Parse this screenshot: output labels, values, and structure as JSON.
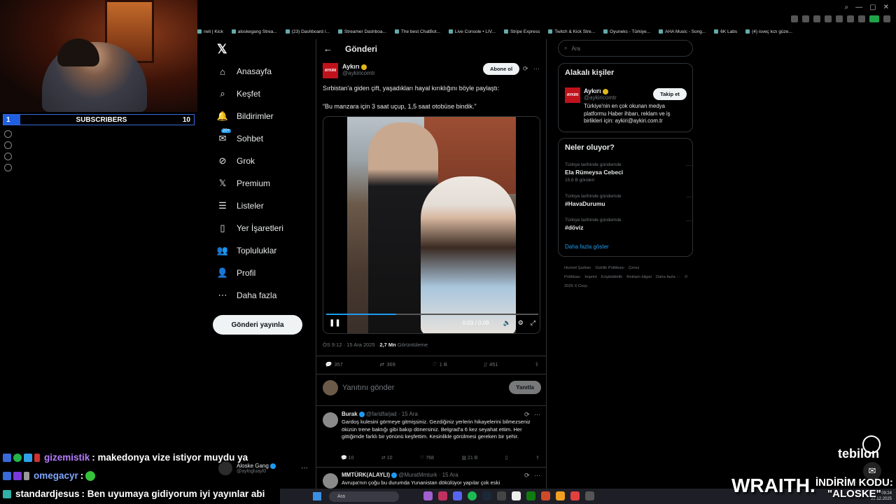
{
  "webcam": {
    "subscribers_label": "SUBSCRIBERS",
    "subscribers_current": "1",
    "subscribers_goal": "10"
  },
  "bookmarks": [
    "neli | Kick",
    "aloskegang Strea...",
    "(23) Dashboard /...",
    "Streamer Dashboa...",
    "The best ChatBot...",
    "Live Console • LIV...",
    "Stripe Express",
    "Twitch & Kick Stre...",
    "Oyuneks - Türkiye...",
    "AHA Music - Song...",
    "6K Labs",
    "(4) isveç kızı güze..."
  ],
  "nav": {
    "items": [
      {
        "label": "Anasayfa",
        "icon": "home-icon"
      },
      {
        "label": "Keşfet",
        "icon": "search-icon"
      },
      {
        "label": "Bildirimler",
        "icon": "bell-icon"
      },
      {
        "label": "Sohbet",
        "icon": "mail-icon",
        "badge": "20+"
      },
      {
        "label": "Grok",
        "icon": "grok-icon"
      },
      {
        "label": "Premium",
        "icon": "x-icon"
      },
      {
        "label": "Listeler",
        "icon": "list-icon"
      },
      {
        "label": "Yer İşaretleri",
        "icon": "bookmark-icon"
      },
      {
        "label": "Topluluklar",
        "icon": "people-icon"
      },
      {
        "label": "Profil",
        "icon": "person-icon"
      },
      {
        "label": "Daha fazla",
        "icon": "more-icon"
      }
    ],
    "post_button": "Gönderi yayınla",
    "account_name": "Aloske Gang",
    "account_handle": "@aylogluayl0"
  },
  "post": {
    "header_title": "Gönderi",
    "author_name": "Aykırı",
    "author_handle": "@aykiricomtr",
    "author_logo": "AYKIRI",
    "subscribe_label": "Abone ol",
    "text1": "Sırbistan'a giden çift, yaşadıkları hayal kırıklığını böyle paylaştı:",
    "text2": "“Bu manzara için 3 saat uçup, 1,5 saat otobüse bindik.”",
    "video_time": "0:03 / 0:09",
    "video_progress": 0.33,
    "meta_time": "ÖS 9:12 · 15 Ara 2025 · ",
    "meta_views": "2,7 Mn",
    "meta_views_label": " Görüntüleme",
    "stats": {
      "replies": "357",
      "reposts": "369",
      "likes": "1 B",
      "bookmarks": "451"
    },
    "reply_placeholder": "Yanıtını gönder",
    "reply_button": "Yanıtla"
  },
  "replies": [
    {
      "name": "Burak",
      "handle": "@faridfarjad",
      "date": "· 15 Ara",
      "text": "Gardoş kulesini görmeye gitmişsiniz. Gezdiğiniz yerlerin hikayelerini bilmezseniz ökizün trene baktığı gibi bakıp dönersiniz. Belgrad'a 6 kez seyahat ettim. Her gittiğimde farklı bir yönünü keşfettim. Kesinlikle görülmesi gereken bir şehir.",
      "stats": {
        "replies": "10",
        "reposts": "10",
        "likes": "768",
        "views": "21 B"
      }
    },
    {
      "name": "MMTÜRK(ALAYLI)",
      "handle": "@MuratMmturk",
      "date": "· 15 Ara",
      "text": "Avrupa'nın çoğu bu durumda Yunanistan dökülüyor yapılar çok eski"
    }
  ],
  "right": {
    "search_placeholder": "Ara",
    "relevant_title": "Alakalı kişiler",
    "relevant_name": "Aykırı",
    "relevant_handle": "@aykiricomtr",
    "relevant_bio": "Türkiye'nin en çok okunan medya platformu Haber ihbarı, reklam ve iş birlikleri için: aykiri@aykiri.com.tr",
    "follow_label": "Takip et",
    "trends_title": "Neler oluyor?",
    "trends": [
      {
        "context": "Türkiye tarihinde gündemde",
        "title": "Ela Rümeysa Cebeci",
        "count": "15,6 B gönderi"
      },
      {
        "context": "Türkiye tarihinde gündemde",
        "title": "#HavaDurumu",
        "count": ""
      },
      {
        "context": "Türkiye tarihinde gündemde",
        "title": "#döviz",
        "count": ""
      }
    ],
    "show_more": "Daha fazla göster",
    "footer_links": [
      "Hizmet Şartları",
      "Gizlilik Politikası",
      "Çerez Politikası",
      "Imprint",
      "Erişilebilirlik",
      "Reklam bilgisi",
      "Daha fazla ···",
      "© 2025 X Corp."
    ]
  },
  "chat": [
    {
      "user": "gizemistik",
      "user_color": "#b57dff",
      "text": ": makedonya vize istiyor muydu ya"
    },
    {
      "user": "omegacyr",
      "user_color": "#7ea6ff",
      "text": ": "
    },
    {
      "user": "standardjesus",
      "user_color": "#ffffff",
      "text": ": Ben uyumaya gidiyorum iyi yayınlar abi"
    }
  ],
  "sponsors": {
    "tebilon": "tebilon",
    "wraith": "WRAITH.",
    "promo_line1": "İNDİRİM KODU:",
    "promo_line2": "\"ALOSKE\""
  },
  "taskbar": {
    "search_placeholder": "Ara",
    "time": "09:24",
    "date": "22.12.2025"
  }
}
